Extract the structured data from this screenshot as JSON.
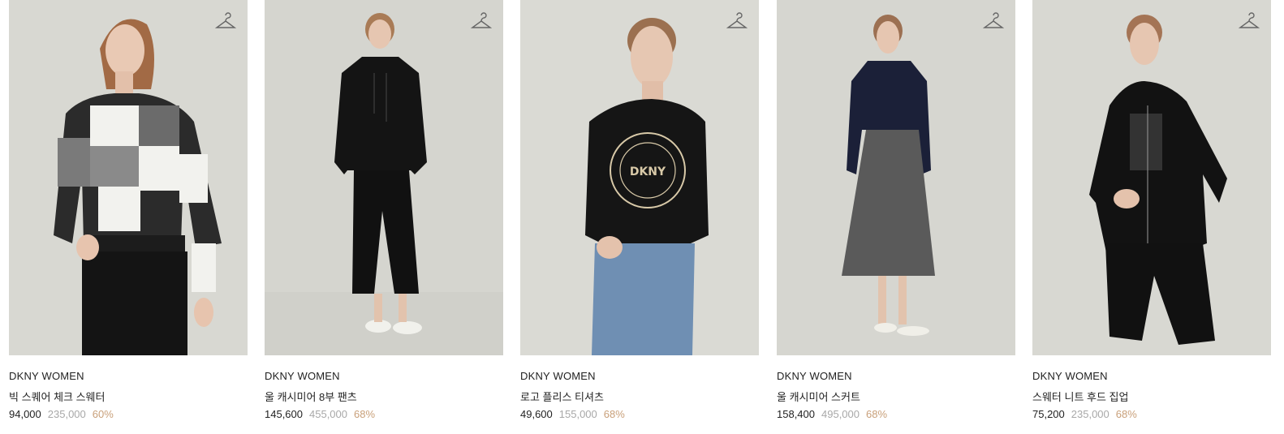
{
  "products": [
    {
      "brand": "DKNY WOMEN",
      "name": "빅 스퀘어 체크 스웨터",
      "sale_price": "94,000",
      "original_price": "235,000",
      "discount": "60%",
      "wishlist_icon": "hanger-icon",
      "bg_color": "#d7d7d1"
    },
    {
      "brand": "DKNY WOMEN",
      "name": "울 캐시미어 8부 팬츠",
      "sale_price": "145,600",
      "original_price": "455,000",
      "discount": "68%",
      "wishlist_icon": "hanger-icon",
      "bg_color": "#d5d5cf"
    },
    {
      "brand": "DKNY WOMEN",
      "name": "로고 플리스 티셔츠",
      "sale_price": "49,600",
      "original_price": "155,000",
      "discount": "68%",
      "wishlist_icon": "hanger-icon",
      "bg_color": "#dadad4"
    },
    {
      "brand": "DKNY WOMEN",
      "name": "울 캐시미어 스커트",
      "sale_price": "158,400",
      "original_price": "495,000",
      "discount": "68%",
      "wishlist_icon": "hanger-icon",
      "bg_color": "#d6d6d0"
    },
    {
      "brand": "DKNY WOMEN",
      "name": "스웨터 니트 후드 집업",
      "sale_price": "75,200",
      "original_price": "235,000",
      "discount": "68%",
      "wishlist_icon": "hanger-icon",
      "bg_color": "#d8d8d2"
    }
  ],
  "colors": {
    "discount": "#c9a07a",
    "original_price": "#a8a8a8",
    "text": "#222222"
  }
}
